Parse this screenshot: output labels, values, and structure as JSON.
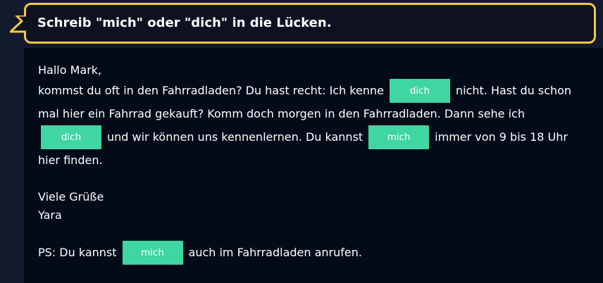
{
  "instruction": "Schreib \"mich\" oder \"dich\" in die Lücken.",
  "letter": {
    "greeting": "Hallo Mark,",
    "line1_a": "kommst du oft in den Fahrradladen? Du hast recht: Ich kenne",
    "blank1": "dich",
    "line1_b": "nicht. Hast du schon",
    "line2": "mal hier ein Fahrrad gekauft? Komm doch morgen in den Fahrradladen. Dann sehe ich",
    "blank2": "dich",
    "line3_a": "und wir können uns kennenlernen. Du kannst",
    "blank3": "mich",
    "line3_b": "immer von 9 bis 18 Uhr",
    "line4": "hier finden.",
    "closing": "Viele Grüße",
    "signature": "Yara",
    "ps_a": "PS: Du kannst",
    "blank4": "mich",
    "ps_b": "auch im Fahrradladen anrufen."
  },
  "colors": {
    "background": "#141a2e",
    "banner_border": "#f4c93f",
    "panel": "#030b18",
    "blank_fill": "#3fd6a1",
    "text": "#ffffff"
  }
}
